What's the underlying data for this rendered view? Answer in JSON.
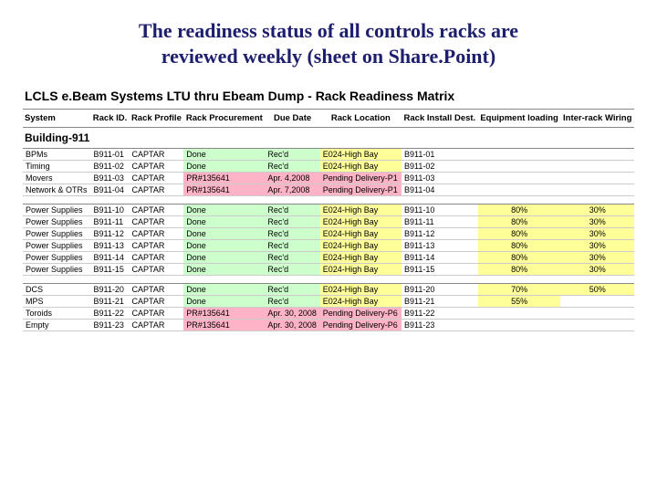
{
  "title_line1": "The readiness status of all controls racks are",
  "title_line2": "reviewed weekly (sheet on Share.Point)",
  "matrix_title": "LCLS e.Beam Systems LTU thru Ebeam Dump - Rack Readiness Matrix",
  "headers": {
    "system": "System",
    "rack_id": "Rack ID.",
    "profile": "Rack Profile",
    "procurement": "Rack Procurement",
    "due": "Due Date",
    "rack_loc": "Rack Location",
    "install_dest": "Rack Install Dest.",
    "equip_load": "Equipment loading",
    "inter_rack": "Inter-rack Wiring"
  },
  "section": "Building-911",
  "rows": [
    {
      "group": 0,
      "system": "BPMs",
      "id": "B911-01",
      "profile": "CAPTAR",
      "proc": "Done",
      "proc_c": "c-green",
      "due": "Rec'd",
      "due_c": "c-green",
      "loc": "E024-High Bay",
      "loc_c": "c-yellow",
      "dest": "B911-01",
      "load": "",
      "il": "",
      "wr": "",
      "wr_c": ""
    },
    {
      "group": 0,
      "system": "Timing",
      "id": "B911-02",
      "profile": "CAPTAR",
      "proc": "Done",
      "proc_c": "c-green",
      "due": "Rec'd",
      "due_c": "c-green",
      "loc": "E024-High Bay",
      "loc_c": "c-yellow",
      "dest": "B911-02",
      "load": "",
      "il": "",
      "wr": "",
      "wr_c": ""
    },
    {
      "group": 0,
      "system": "Movers",
      "id": "B911-03",
      "profile": "CAPTAR",
      "proc": "PR#135641",
      "proc_c": "c-pink",
      "due": "Apr. 4,2008",
      "due_c": "c-pink",
      "loc": "Pending Delivery-P1",
      "loc_c": "c-pink",
      "dest": "B911-03",
      "load": "",
      "il": "",
      "wr": "",
      "wr_c": ""
    },
    {
      "group": 0,
      "system": "Network & OTRs",
      "id": "B911-04",
      "profile": "CAPTAR",
      "proc": "PR#135641",
      "proc_c": "c-pink",
      "due": "Apr. 7,2008",
      "due_c": "c-pink",
      "loc": "Pending Delivery-P1",
      "loc_c": "c-pink",
      "dest": "B911-04",
      "load": "",
      "il": "",
      "wr": "",
      "wr_c": ""
    },
    {
      "group": 1,
      "system": "Power Supplies",
      "id": "B911-10",
      "profile": "CAPTAR",
      "proc": "Done",
      "proc_c": "c-green",
      "due": "Rec'd",
      "due_c": "c-green",
      "loc": "E024-High Bay",
      "loc_c": "c-yellow",
      "dest": "B911-10",
      "load": "80%",
      "il": "c-yellow",
      "wr": "30%",
      "wr_c": "c-yellow"
    },
    {
      "group": 1,
      "system": "Power Supplies",
      "id": "B911-11",
      "profile": "CAPTAR",
      "proc": "Done",
      "proc_c": "c-green",
      "due": "Rec'd",
      "due_c": "c-green",
      "loc": "E024-High Bay",
      "loc_c": "c-yellow",
      "dest": "B911-11",
      "load": "80%",
      "il": "c-yellow",
      "wr": "30%",
      "wr_c": "c-yellow"
    },
    {
      "group": 1,
      "system": "Power Supplies",
      "id": "B911-12",
      "profile": "CAPTAR",
      "proc": "Done",
      "proc_c": "c-green",
      "due": "Rec'd",
      "due_c": "c-green",
      "loc": "E024-High Bay",
      "loc_c": "c-yellow",
      "dest": "B911-12",
      "load": "80%",
      "il": "c-yellow",
      "wr": "30%",
      "wr_c": "c-yellow"
    },
    {
      "group": 1,
      "system": "Power Supplies",
      "id": "B911-13",
      "profile": "CAPTAR",
      "proc": "Done",
      "proc_c": "c-green",
      "due": "Rec'd",
      "due_c": "c-green",
      "loc": "E024-High Bay",
      "loc_c": "c-yellow",
      "dest": "B911-13",
      "load": "80%",
      "il": "c-yellow",
      "wr": "30%",
      "wr_c": "c-yellow"
    },
    {
      "group": 1,
      "system": "Power Supplies",
      "id": "B911-14",
      "profile": "CAPTAR",
      "proc": "Done",
      "proc_c": "c-green",
      "due": "Rec'd",
      "due_c": "c-green",
      "loc": "E024-High Bay",
      "loc_c": "c-yellow",
      "dest": "B911-14",
      "load": "80%",
      "il": "c-yellow",
      "wr": "30%",
      "wr_c": "c-yellow"
    },
    {
      "group": 1,
      "system": "Power Supplies",
      "id": "B911-15",
      "profile": "CAPTAR",
      "proc": "Done",
      "proc_c": "c-green",
      "due": "Rec'd",
      "due_c": "c-green",
      "loc": "E024-High Bay",
      "loc_c": "c-yellow",
      "dest": "B911-15",
      "load": "80%",
      "il": "c-yellow",
      "wr": "30%",
      "wr_c": "c-yellow"
    },
    {
      "group": 2,
      "system": "DCS",
      "id": "B911-20",
      "profile": "CAPTAR",
      "proc": "Done",
      "proc_c": "c-green",
      "due": "Rec'd",
      "due_c": "c-green",
      "loc": "E024-High Bay",
      "loc_c": "c-yellow",
      "dest": "B911-20",
      "load": "70%",
      "il": "c-yellow",
      "wr": "50%",
      "wr_c": "c-yellow"
    },
    {
      "group": 2,
      "system": "MPS",
      "id": "B911-21",
      "profile": "CAPTAR",
      "proc": "Done",
      "proc_c": "c-green",
      "due": "Rec'd",
      "due_c": "c-green",
      "loc": "E024-High Bay",
      "loc_c": "c-yellow",
      "dest": "B911-21",
      "load": "55%",
      "il": "c-yellow",
      "wr": "",
      "wr_c": ""
    },
    {
      "group": 2,
      "system": "Toroids",
      "id": "B911-22",
      "profile": "CAPTAR",
      "proc": "PR#135641",
      "proc_c": "c-pink",
      "due": "Apr. 30, 2008",
      "due_c": "c-pink",
      "loc": "Pending Delivery-P6",
      "loc_c": "c-pink",
      "dest": "B911-22",
      "load": "",
      "il": "",
      "wr": "",
      "wr_c": ""
    },
    {
      "group": 2,
      "system": "Empty",
      "id": "B911-23",
      "profile": "CAPTAR",
      "proc": "PR#135641",
      "proc_c": "c-pink",
      "due": "Apr. 30, 2008",
      "due_c": "c-pink",
      "loc": "Pending Delivery-P6",
      "loc_c": "c-pink",
      "dest": "B911-23",
      "load": "",
      "il": "",
      "wr": "",
      "wr_c": ""
    }
  ]
}
